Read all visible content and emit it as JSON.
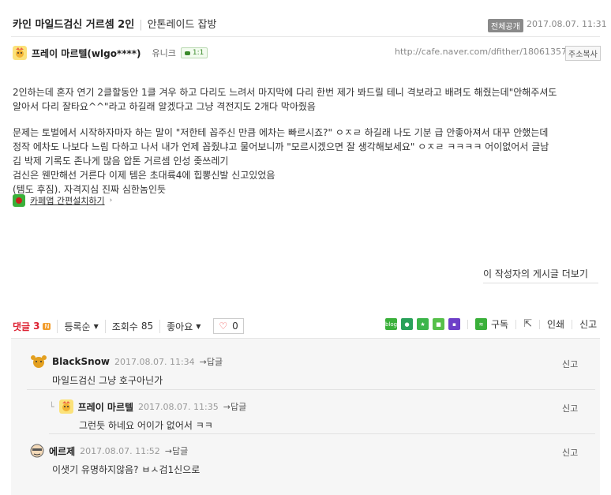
{
  "post": {
    "title": "카인 마일드검신 거르셈 2인",
    "board": "안톤레이드 잡방",
    "visibility_badge": "전체공개",
    "date": "2017.08.07. 11:31",
    "author": "프레이 마르텔(wlgo****)",
    "grade": "유니크",
    "chat_badge": "1:1",
    "url": "http://cafe.naver.com/dfither/18061357",
    "copy_button": "주소복사",
    "body_lines_1": [
      "2인하는데 혼자 연기 2클할동안 1클 겨우 하고 다리도 느려서 마지막에 다리 한번 제가 봐드릴 테니 격보라고 배려도 해줬는데\"안해주셔도",
      "알아서 다리 잘타요^^\"라고 하길래 알겠다고 그냥 격전지도 2개다 막아줬음"
    ],
    "body_lines_2": [
      "문제는 토벌에서 시작하자마자 하는 말이 \"저한테 꼽주신 만큼 에차는 빠르시죠?\" ㅇㅈㄹ 하길래 나도 기분 급 안좋아져서 대꾸 안했는데",
      "정작 에차도 나보다 느림 다하고 나서 내가 언제 꼽줬냐고 물어보니까 \"모르시겠으면 잘 생각해보세요\" ㅇㅈㄹ ㅋㅋㅋㅋ 어이없어서 글남",
      "김 박제 기록도 존나게 많음 압톤 거르셈 인성 좆쓰레기",
      "검신은 웬만해선 거른다 이제 템은 초대륙4에 힙뽕신발 신고있었음",
      "(템도 후짐). 자격지심 진짜 심한놈인듯"
    ],
    "app_link": "카페앱 간편설치하기",
    "more_posts": "이 작성자의 게시글 더보기"
  },
  "toolbar": {
    "comments_label": "댓글",
    "comments_count": "3",
    "new_badge": "N",
    "sort": "등록순",
    "views_label": "조회수",
    "views": "85",
    "likes_label": "좋아요",
    "like_count": "0"
  },
  "share": {
    "blog": "blog",
    "subscribe": "구독",
    "print": "인쇄",
    "report": "신고"
  },
  "comments": [
    {
      "name": "BlackSnow",
      "date": "2017.08.07. 11:34",
      "reply": "답글",
      "text": "마일드검신 그냥 호구아닌가",
      "report": "신고"
    },
    {
      "name": "프레이 마르텔",
      "date": "2017.08.07. 11:35",
      "reply": "답글",
      "text": "그런듯 하네요 어이가 없어서 ㅋㅋ",
      "report": "신고"
    },
    {
      "name": "에르제",
      "date": "2017.08.07. 11:52",
      "reply": "답글",
      "text": "이샛기 유명하지않음? ㅂㅅ검1신으로",
      "report": "신고"
    }
  ],
  "colors": {
    "comment_accent": "#dd2233",
    "new_badge": "#f29d2d",
    "share_green": "#3ab03a",
    "comment_bg": "#f6f6f6"
  }
}
